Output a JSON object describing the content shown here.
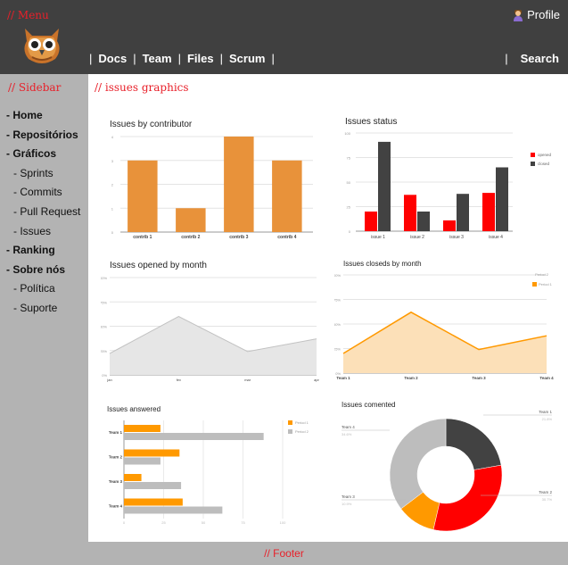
{
  "header": {
    "menu_label": "// Menu",
    "profile_label": "Profile",
    "profile_icon": "user-icon",
    "nav": [
      "Docs",
      "Team",
      "Files",
      "Scrum"
    ],
    "search_label": "Search"
  },
  "sidebar": {
    "label": "// Sidebar",
    "items": [
      {
        "label": "- Home",
        "level": "top"
      },
      {
        "label": "- Repositórios",
        "level": "top"
      },
      {
        "label": "- Gráficos",
        "level": "top"
      },
      {
        "label": "- Sprints",
        "level": "sub"
      },
      {
        "label": "- Commits",
        "level": "sub"
      },
      {
        "label": "- Pull Request",
        "level": "sub"
      },
      {
        "label": "- Issues",
        "level": "sub"
      },
      {
        "label": "- Ranking",
        "level": "top"
      },
      {
        "label": "- Sobre nós",
        "level": "top"
      },
      {
        "label": "- Política",
        "level": "sub"
      },
      {
        "label": "- Suporte",
        "level": "sub"
      }
    ]
  },
  "main": {
    "label": "// issues graphics"
  },
  "footer": {
    "label": "// Footer"
  },
  "colors": {
    "orange": "#e8923a",
    "red": "#ff0000",
    "dark": "#424242",
    "gold": "#ff9900",
    "grey": "#bdbdbd"
  },
  "chart_data": [
    {
      "type": "bar",
      "title": "Issues by contributor",
      "categories": [
        "contrib 1",
        "contrib 2",
        "contrib 3",
        "contrib 4"
      ],
      "values": [
        3,
        1,
        4,
        3
      ],
      "ylim": [
        0,
        4
      ],
      "yticks": [
        "0",
        "1",
        "2",
        "3",
        "4"
      ]
    },
    {
      "type": "bar",
      "title": "Issues status",
      "categories": [
        "issue 1",
        "issue 2",
        "issue 3",
        "issue 4"
      ],
      "series": [
        {
          "name": "opened",
          "values": [
            20,
            37,
            11,
            39
          ]
        },
        {
          "name": "closed",
          "values": [
            91,
            20,
            38,
            65
          ]
        }
      ],
      "ylim": [
        0,
        100
      ],
      "yticks": [
        "0",
        "25",
        "50",
        "75",
        "100"
      ],
      "legend": "top-right"
    },
    {
      "type": "area",
      "title": "Issues opened by month",
      "categories": [
        "jan",
        "fev",
        "mar",
        "apr"
      ],
      "values": [
        22,
        60,
        24,
        37
      ],
      "ylim": [
        0,
        100
      ],
      "yticks": [
        "0%",
        "25%",
        "50%",
        "75%",
        "100%"
      ]
    },
    {
      "type": "area",
      "title": "Issues closeds by month",
      "categories": [
        "Team 1",
        "Team 2",
        "Team 3",
        "Team 4"
      ],
      "values": [
        20,
        62,
        24,
        38
      ],
      "ylim": [
        0,
        100
      ],
      "yticks": [
        "0%",
        "25%",
        "50%",
        "75%",
        "100%"
      ],
      "legend_entries": [
        "Period 2",
        "Period 1"
      ],
      "legend": "top-right"
    },
    {
      "type": "bar",
      "orientation": "horizontal",
      "title": "Issues answered",
      "categories": [
        "Team 1",
        "Team 2",
        "Team 3",
        "Team 4"
      ],
      "series": [
        {
          "name": "Period 1",
          "values": [
            23,
            35,
            11,
            37
          ]
        },
        {
          "name": "Period 2",
          "values": [
            88,
            23,
            36,
            62
          ]
        }
      ],
      "xlim": [
        0,
        100
      ],
      "xticks": [
        "0",
        "25",
        "50",
        "75",
        "100"
      ],
      "legend": "top-right"
    },
    {
      "type": "pie",
      "title": "Issues comented",
      "labels": [
        "Team 1",
        "Team 2",
        "Team 3",
        "Team 4"
      ],
      "values": [
        21.8,
        30.7,
        10.9,
        34.6
      ],
      "percent_labels": [
        "21.8%",
        "30.7%",
        "10.9%",
        "34.6%"
      ],
      "donut": true
    }
  ]
}
